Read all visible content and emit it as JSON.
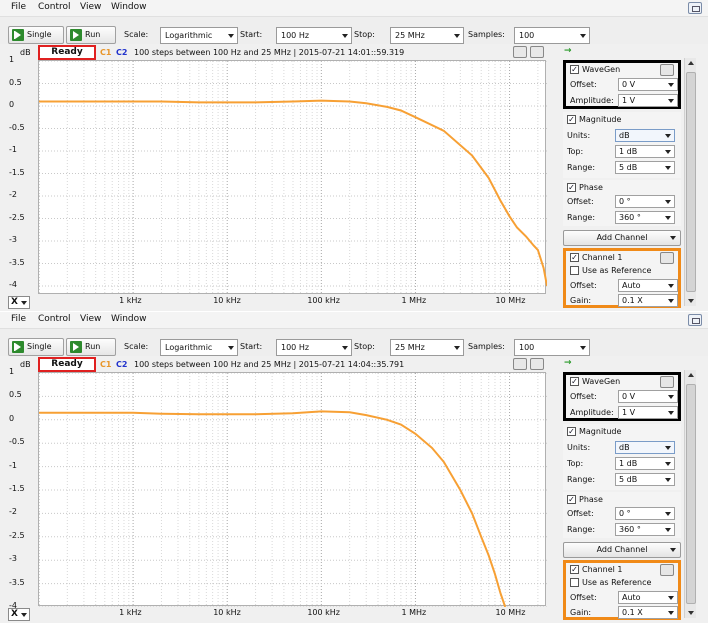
{
  "menu": [
    "File",
    "Control",
    "View",
    "Window"
  ],
  "toolbar": {
    "single_label": "Single",
    "run_label": "Run",
    "scale_label": "Scale:",
    "scale_value": "Logarithmic",
    "start_label": "Start:",
    "start_value": "100 Hz",
    "stop_label": "Stop:",
    "stop_value": "25 MHz",
    "samples_label": "Samples:",
    "samples_value": "100"
  },
  "plot_common": {
    "y_unit": "dB",
    "c1_label": "C1",
    "c2_label": "C2",
    "y_ticks": [
      "1",
      "0.5",
      "0",
      "-0.5",
      "-1",
      "-1.5",
      "-2",
      "-2.5",
      "-3",
      "-3.5",
      "-4"
    ],
    "x_ticks": [
      "1 kHz",
      "10 kHz",
      "100 kHz",
      "1 MHz",
      "10 MHz"
    ],
    "x_axis_selector": "X",
    "trace_color": "#f7a034"
  },
  "sidebar": {
    "wavegen_title": "WaveGen",
    "offset_label": "Offset:",
    "offset_value": "0 V",
    "amplitude_label": "Amplitude:",
    "amplitude_value": "1 V",
    "magnitude_title": "Magnitude",
    "units_label": "Units:",
    "units_value": "dB",
    "top_label": "Top:",
    "top_value": "1 dB",
    "range_label": "Range:",
    "range_value": "5 dB",
    "phase_title": "Phase",
    "phase_offset_value": "0 °",
    "phase_range_value": "360 °",
    "add_channel_label": "Add Channel",
    "channel1_title": "Channel 1",
    "use_as_reference_label": "Use as Reference",
    "ch_offset_value": "Auto",
    "gain_label": "Gain:",
    "gain_value": "0.1 X",
    "checkmark": "✓"
  },
  "instances": [
    {
      "status_label": "Ready",
      "status_text": "100 steps  between 100 Hz and 25 MHz | 2015-07-21 14:01::59.319"
    },
    {
      "status_label": "Ready",
      "status_text": "100 steps  between 100 Hz and 25 MHz | 2015-07-21 14:04::35.791"
    }
  ],
  "chart_data": [
    {
      "type": "line",
      "xscale": "log",
      "xlim": [
        100,
        25000000
      ],
      "ylim": [
        -4.2,
        1
      ],
      "ylabel": "dB",
      "grid": true,
      "series": [
        {
          "name": "C1",
          "color": "#f7a034",
          "x": [
            100,
            200,
            500,
            1000,
            2000,
            5000,
            10000,
            20000,
            50000,
            100000,
            200000,
            300000,
            500000,
            700000,
            1000000,
            2000000,
            4000000,
            6000000,
            8000000,
            10000000,
            12000000,
            15000000,
            18000000,
            20000000,
            23000000,
            25000000
          ],
          "y": [
            0.1,
            0.1,
            0.1,
            0.1,
            0.1,
            0.08,
            0.08,
            0.08,
            0.1,
            0.12,
            0.1,
            0.06,
            -0.02,
            -0.1,
            -0.25,
            -0.55,
            -1.1,
            -1.6,
            -2.1,
            -2.45,
            -2.7,
            -2.9,
            -3.1,
            -3.2,
            -3.6,
            -4.0
          ]
        }
      ]
    },
    {
      "type": "line",
      "xscale": "log",
      "xlim": [
        100,
        25000000
      ],
      "ylim": [
        -4,
        1
      ],
      "ylabel": "dB",
      "grid": true,
      "series": [
        {
          "name": "C1",
          "color": "#f7a034",
          "x": [
            100,
            200,
            500,
            1000,
            2000,
            5000,
            10000,
            20000,
            50000,
            100000,
            200000,
            300000,
            500000,
            700000,
            1000000,
            1500000,
            2000000,
            3000000,
            4000000,
            5000000,
            6000000,
            7000000,
            8000000,
            9000000
          ],
          "y": [
            0.15,
            0.15,
            0.15,
            0.15,
            0.13,
            0.12,
            0.12,
            0.12,
            0.14,
            0.18,
            0.16,
            0.1,
            0.0,
            -0.1,
            -0.3,
            -0.6,
            -0.9,
            -1.5,
            -2.0,
            -2.5,
            -2.9,
            -3.3,
            -3.7,
            -4.0
          ]
        }
      ]
    }
  ]
}
